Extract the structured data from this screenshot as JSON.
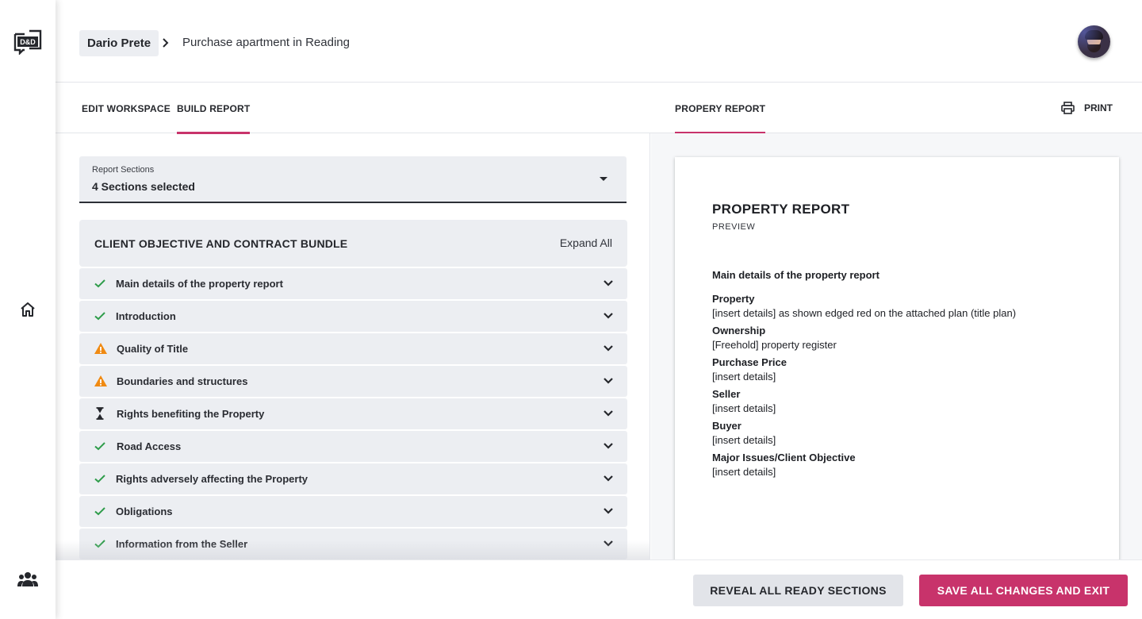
{
  "app": {
    "logo_icon": "dd-logo-icon",
    "nav_icons": [
      "home-icon",
      "people-icon"
    ]
  },
  "header": {
    "breadcrumb_client": "Dario Prete",
    "breadcrumb_project": "Purchase apartment in Reading",
    "avatar_icon": "user-avatar"
  },
  "tabs": {
    "edit_workspace": "EDIT WORKSPACE",
    "build_report": "BUILD REPORT",
    "property_report": "PROPERY REPORT",
    "print": "PRINT",
    "active": "BUILD REPORT",
    "accent_color": "#c8336b"
  },
  "report_sections_select": {
    "label": "Report Sections",
    "value": "4 Sections selected"
  },
  "bundle": {
    "title": "CLIENT OBJECTIVE AND CONTRACT BUNDLE",
    "expand_label": "Expand All"
  },
  "sections": [
    {
      "label": "Main details of the property report",
      "status": "ready",
      "icon": "check-icon"
    },
    {
      "label": "Introduction",
      "status": "ready",
      "icon": "check-icon"
    },
    {
      "label": "Quality of Title",
      "status": "warning",
      "icon": "warning-icon"
    },
    {
      "label": "Boundaries and structures",
      "status": "warning",
      "icon": "warning-icon"
    },
    {
      "label": "Rights benefiting the Property",
      "status": "pending",
      "icon": "hourglass-icon"
    },
    {
      "label": "Road Access",
      "status": "ready",
      "icon": "check-icon"
    },
    {
      "label": "Rights adversely affecting the Property",
      "status": "ready",
      "icon": "check-icon"
    },
    {
      "label": "Obligations",
      "status": "ready",
      "icon": "check-icon"
    },
    {
      "label": "Information from the Seller",
      "status": "ready",
      "icon": "check-icon"
    }
  ],
  "status_colors": {
    "ready": "#2e9c4a",
    "warning": "#f08a12",
    "pending": "#25272c"
  },
  "preview": {
    "title": "PROPERTY REPORT",
    "subtitle": "PREVIEW",
    "main_heading": "Main details of the property report",
    "fields": [
      {
        "key": "Property",
        "value": "[insert details] as shown edged red on the attached plan (title plan)"
      },
      {
        "key": "Ownership",
        "value": "[Freehold] property register"
      },
      {
        "key": "Purchase Price",
        "value": "[insert details]"
      },
      {
        "key": "Seller",
        "value": "[insert details]"
      },
      {
        "key": "Buyer",
        "value": "[insert details]"
      },
      {
        "key": "Major Issues/Client Objective",
        "value": "[insert details]"
      }
    ]
  },
  "footer": {
    "reveal_label": "REVEAL ALL READY SECTIONS",
    "save_label": "SAVE ALL CHANGES AND EXIT"
  }
}
